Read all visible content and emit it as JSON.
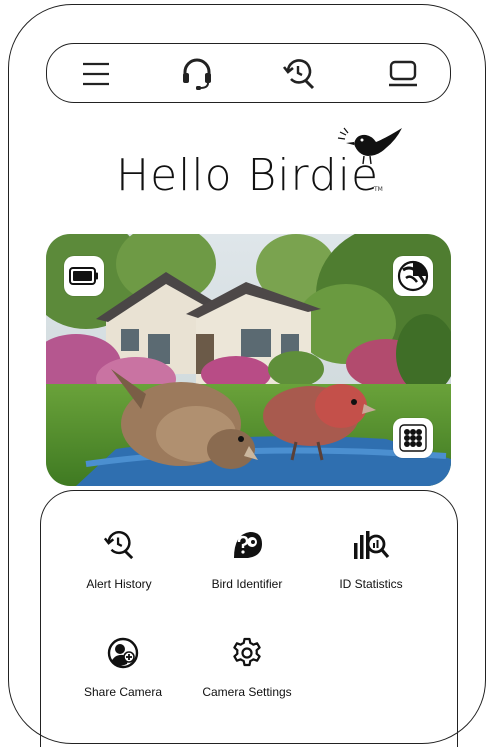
{
  "app": {
    "title": "Hello Birdie",
    "trademark": "TM"
  },
  "topbar": {
    "menu_icon": "hamburger-menu-icon",
    "support_icon": "headset-icon",
    "history_icon": "history-search-icon",
    "device_icon": "laptop-icon"
  },
  "camera": {
    "battery_icon": "battery-full-icon",
    "mode_icon": "day-night-icon",
    "grid_icon": "grid-menu-icon"
  },
  "menu": {
    "items": [
      {
        "label": "Alert History",
        "icon": "history-search-icon"
      },
      {
        "label": "Bird Identifier",
        "icon": "bird-question-icon"
      },
      {
        "label": "ID Statistics",
        "icon": "bar-chart-search-icon"
      },
      {
        "label": "Share Camera",
        "icon": "add-user-icon"
      },
      {
        "label": "Camera Settings",
        "icon": "gear-icon"
      }
    ]
  },
  "colors": {
    "outline": "#222222",
    "background": "#ffffff"
  }
}
